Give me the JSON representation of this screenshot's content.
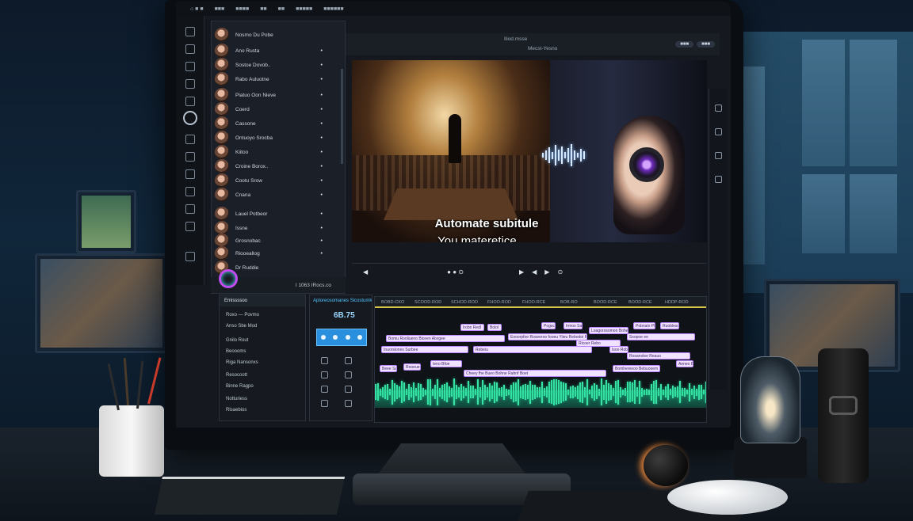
{
  "menubar": {
    "items": [
      "⌂ ■ ■",
      "■■■",
      "■■■■",
      "■■",
      "■■",
      "■■■■■",
      "■■■■■■"
    ]
  },
  "media_list": {
    "items": [
      {
        "name": "Nosmo Du Pobe"
      },
      {
        "name": "Ano Rusta"
      },
      {
        "name": "Sostoe Dovob.."
      },
      {
        "name": "Rabo Auluotne"
      },
      {
        "name": "Piatuo Oon Nieve"
      },
      {
        "name": "Coerd"
      },
      {
        "name": "Cassone"
      },
      {
        "name": "Ontuoyo Srocba"
      },
      {
        "name": "Kiitoo"
      },
      {
        "name": "Croine Borox.."
      },
      {
        "name": "Cootu Srow"
      },
      {
        "name": "Cnana"
      },
      {
        "name": "Lauel Potbeor"
      },
      {
        "name": "Issne"
      },
      {
        "name": "Grosnobac"
      },
      {
        "name": "Riooeallog"
      },
      {
        "name": "Dr Ruddie"
      }
    ],
    "footer_text": "I 1063 IRocs.co"
  },
  "preview": {
    "header_title": "Iliod.msse",
    "header_sub": "Mecst-Yesno",
    "pills": [
      "■■■",
      "■■■"
    ],
    "subtitle_line1": "Automate subitule",
    "subtitle_line2": "You materetice.",
    "colors": {
      "subtitle": "#ffffff",
      "accent": "#c24cf0"
    }
  },
  "transport": {
    "buttons": [
      "◀",
      "● ● ⊙",
      "▶",
      "◀",
      "▶",
      "⊙"
    ]
  },
  "effects_panel": {
    "title": "Emissssoo",
    "rows": [
      {
        "label": "Roxo — Povmo"
      },
      {
        "label": "Anso Sbe Mod"
      },
      {
        "label": "Gnilo Rout"
      },
      {
        "label": "Beoooms"
      },
      {
        "label": "Riga Nansonxs"
      },
      {
        "label": "Resocoott"
      },
      {
        "label": "Binne Ragpo"
      },
      {
        "label": "Notturiess"
      },
      {
        "label": "Rlsaebios"
      }
    ]
  },
  "mid_panel": {
    "title": "Aploreosomanes Sicostumkeess",
    "counter": "6B.75",
    "colors": {
      "accent": "#2a8fdc"
    }
  },
  "timeline": {
    "ruler_labels": [
      "BOBD-CKO",
      "SCOOD-ROD",
      "SCHOD-ROD",
      "FHOO-ROD",
      "FHOO-RCE",
      "BOB-RO",
      "BOOD-RCE",
      "BOOD-RCE",
      "HDDP-ROD"
    ],
    "captions": [
      "Irobn Redl",
      "Bolol",
      "Pogsco Roy",
      "Irmoo Sarbe",
      "Loagorosomon Bohe",
      "Pobnalo Pluhre",
      "Ruobleso Rornteo Rigu Noe",
      "Bomu Rooliueno Biceen Alsrgee",
      "Eooorpfoe Roseeroo fooeu Yiieu Rebedoi Rahorg",
      "Ricoer Rebo",
      "Ssopoe ee",
      "Inuorsiones Surbee",
      "Rebeiu",
      "Isoo Robbaces Rinere Rorpoe",
      "Rosanolee Reauo",
      "Beee Sau",
      "Rooeue",
      "Cheey fhe Bueo Bohne Rahnf Boet",
      "Ieno Bfoe",
      "Bomhereeoo Bebuooem",
      "Aeneo Bonb"
    ],
    "colors": {
      "caption_bg": "#f1e3ff",
      "playhead": "#d8c84a",
      "waveform": "#39e3a6"
    }
  }
}
